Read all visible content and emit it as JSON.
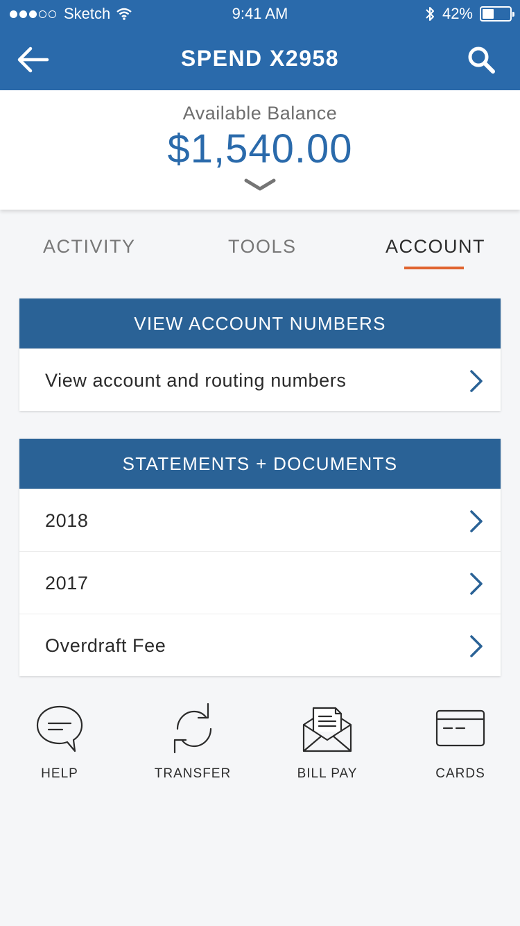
{
  "status_bar": {
    "carrier": "Sketch",
    "time": "9:41 AM",
    "battery": "42%",
    "battery_level": 0.42,
    "signal_dots_filled": 3,
    "signal_dots_total": 5
  },
  "header": {
    "title": "SPEND X2958",
    "back_icon": "arrow-left-icon",
    "search_icon": "search-icon",
    "color": "#2a6aab"
  },
  "balance": {
    "label": "Available Balance",
    "amount": "$1,540.00",
    "expand_icon": "chevron-down-icon"
  },
  "tabs": {
    "items": [
      {
        "label": "ACTIVITY"
      },
      {
        "label": "TOOLS"
      },
      {
        "label": "ACCOUNT"
      }
    ],
    "active_index": 2,
    "accent": "#e0642f"
  },
  "account_numbers": {
    "header": "VIEW ACCOUNT NUMBERS",
    "rows": [
      {
        "label": "View account and routing numbers"
      }
    ]
  },
  "statements": {
    "header": "STATEMENTS + DOCUMENTS",
    "rows": [
      {
        "label": "2018"
      },
      {
        "label": "2017"
      },
      {
        "label": "Overdraft Fee"
      }
    ]
  },
  "actions": [
    {
      "label": "HELP",
      "icon": "chat-bubble-icon"
    },
    {
      "label": "TRANSFER",
      "icon": "refresh-arrows-icon"
    },
    {
      "label": "BILL PAY",
      "icon": "envelope-icon"
    },
    {
      "label": "CARDS",
      "icon": "credit-card-icon"
    }
  ]
}
